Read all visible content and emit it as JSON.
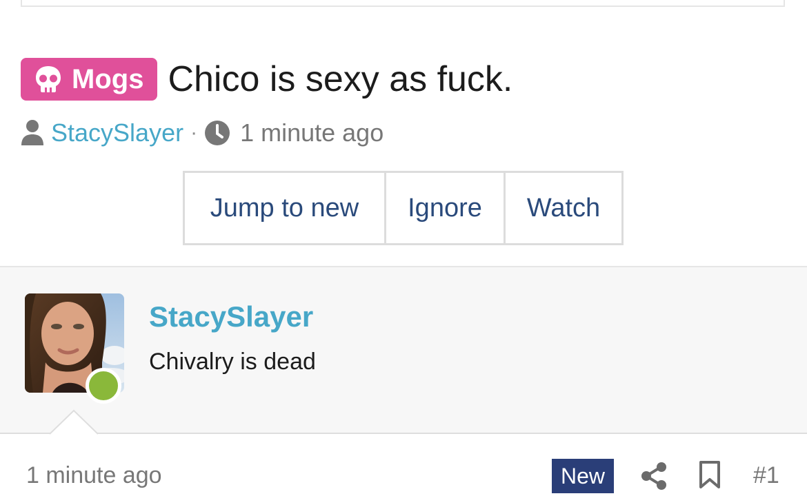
{
  "thread": {
    "prefix_label": "Mogs",
    "title": "Chico is sexy as fuck.",
    "author": "StacySlayer",
    "separator": "·",
    "time": "1 minute ago"
  },
  "actions": {
    "jump_label": "Jump to new",
    "ignore_label": "Ignore",
    "watch_label": "Watch"
  },
  "message": {
    "username": "StacySlayer",
    "text": "Chivalry is dead",
    "online": true
  },
  "footer": {
    "time": "1 minute ago",
    "new_label": "New",
    "post_number": "#1"
  },
  "icons": {
    "prefix": "skull-icon",
    "author": "user-icon",
    "time": "clock-icon",
    "share": "share-icon",
    "bookmark": "bookmark-icon"
  },
  "colors": {
    "prefix_badge": "#e0509a",
    "link": "#47a7c8",
    "button_text": "#2a4a7b",
    "new_badge": "#2a3e78",
    "online": "#8ab83a"
  }
}
